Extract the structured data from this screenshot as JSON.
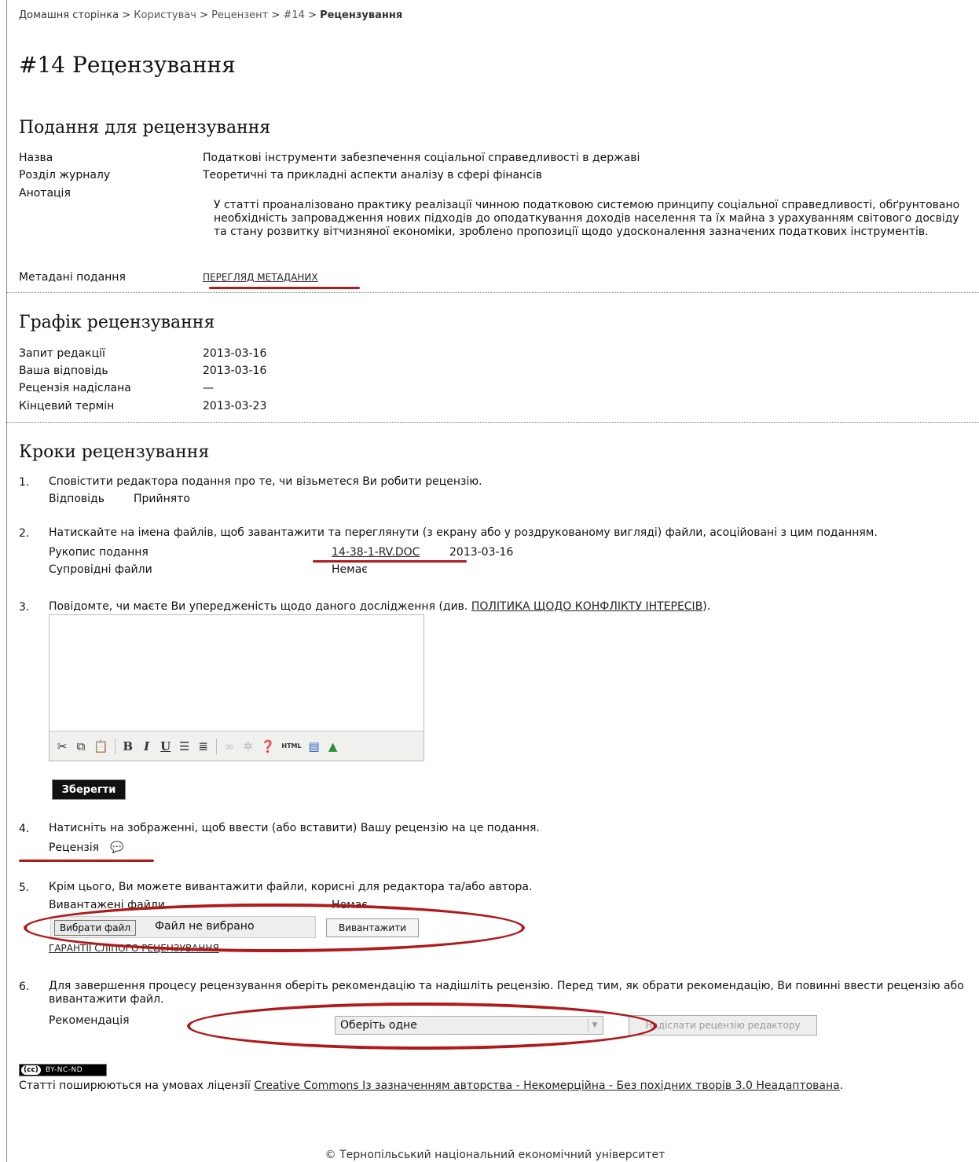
{
  "breadcrumb": {
    "home": "Домашня сторінка",
    "user": "Користувач",
    "reviewer": "Рецензент",
    "id": "#14",
    "current": "Рецензування",
    "separator": ">"
  },
  "page_title": "#14 Рецензування",
  "submission": {
    "heading": "Подання для рецензування",
    "title_label": "Назва",
    "title_value": "Податкові інструменти забезпечення соціальної справедливості в державі",
    "section_label": "Розділ журналу",
    "section_value": "Теоретичні та прикладні аспекти аналізу в сфері фінансів",
    "abstract_label": "Анотація",
    "abstract_value": "У статті проаналізовано практику реалізації чинною податковою системою принципу соціальної справедливості, обґрунтовано необхідність запровадження нових підходів до оподаткування доходів населення та їх майна з урахуванням світового досвіду та стану розвитку вітчизняної економіки, зроблено пропозиції щодо удосконалення зазначених податкових інструментів.",
    "metadata_label": "Метадані подання",
    "metadata_link": "ПЕРЕГЛЯД МЕТАДАНИХ"
  },
  "schedule": {
    "heading": "Графік рецензування",
    "request_label": "Запит редакції",
    "request_value": "2013-03-16",
    "response_label": "Ваша відповідь",
    "response_value": "2013-03-16",
    "sent_label": "Рецензія надіслана",
    "sent_value": "—",
    "due_label": "Кінцевий термін",
    "due_value": "2013-03-23"
  },
  "steps": {
    "heading": "Кроки рецензування",
    "s1_num": "1.",
    "s1_text": "Сповістити редактора подання про те, чи візьметеся Ви робити рецензію.",
    "s1_answer_label": "Відповідь",
    "s1_answer_value": "Прийнято",
    "s2_num": "2.",
    "s2_text": "Натискайте на імена файлів, щоб завантажити та переглянути (з екрану або у роздрукованому вигляді) файли, асоційовані з цим поданням.",
    "s2_manuscript_label": "Рукопис подання",
    "s2_manuscript_file": "14-38-1-RV.DOC",
    "s2_manuscript_date": "2013-03-16",
    "s2_supp_label": "Супровідні файли",
    "s2_supp_value": "Немає",
    "s3_num": "3.",
    "s3_text": "Повідомте, чи маєте Ви упередженість щодо даного дослідження (див.",
    "s3_link": "ПОЛІТИКА ЩОДО КОНФЛІКТУ ІНТЕРЕСІВ",
    "s3_end": ").",
    "save_button": "Зберегти",
    "s4_num": "4.",
    "s4_text": "Натисніть на зображенні, щоб ввести (або вставити) Вашу рецензію на це подання.",
    "s4_review_label": "Рецензія",
    "s5_num": "5.",
    "s5_text": "Крім цього, Ви можете вивантажити файли, корисні для редактора та/або автора.",
    "s5_uploaded_label": "Вивантажені файли",
    "s5_uploaded_value": "Немає",
    "s5_choose_file": "Вибрати файл",
    "s5_no_file": "Файл не вибрано",
    "s5_upload_button": "Вивантажити",
    "s5_blind_link": "ГАРАНТІЇ СЛІПОГО РЕЦЕНЗУВАННЯ",
    "s6_num": "6.",
    "s6_text": "Для завершення процесу рецензування оберіть рекомендацію та надішліть рецензію. Перед тим, як обрати рекомендацію, Ви повинні ввести рецензію або вивантажити файл.",
    "s6_rec_label": "Рекомендація",
    "s6_select_value": "Оберіть одне",
    "s6_send_button": "Надіслати рецензію редактору"
  },
  "toolbar_icons": [
    "cut-icon",
    "copy-icon",
    "paste-icon",
    "bold-icon",
    "italic-icon",
    "underline-icon",
    "bullet-list-icon",
    "numbered-list-icon",
    "link-icon",
    "unlink-icon",
    "help-icon",
    "html-icon",
    "fullscreen-icon",
    "image-icon"
  ],
  "license": {
    "badge_cc": "(cc)",
    "badge_text": "BY-NC-ND",
    "text": "Статті поширюються на умовах ліцензії",
    "link": "Creative Commons Із зазначенням авторства - Некомерційна - Без похідних творів 3.0 Неадаптована",
    "end": "."
  },
  "footer": "© Тернопільський національний економічний університет",
  "colors": {
    "annotation_red": "#b01a1a"
  }
}
